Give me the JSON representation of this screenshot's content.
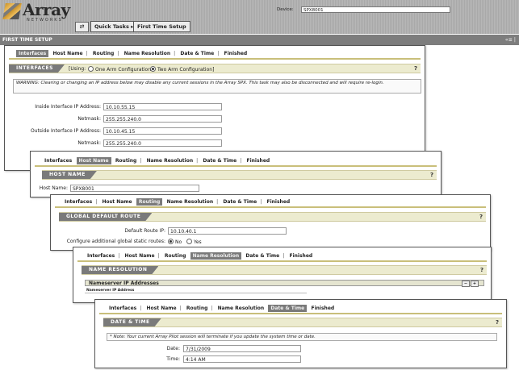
{
  "header": {
    "logo": "Array",
    "logo_sub": "NETWORKS",
    "device_label": "Device:",
    "device_value": "SPX8001",
    "quick_tasks": "Quick Tasks ▸",
    "first_time_setup": "First Time Setup"
  },
  "window": {
    "title": "FIRST TIME SETUP",
    "title_right": "«≡ |"
  },
  "tabs": {
    "interfaces": "Interfaces",
    "host_name": "Host Name",
    "routing": "Routing",
    "name_resolution": "Name Resolution",
    "date_time": "Date & Time",
    "finished": "Finished",
    "separator": "|"
  },
  "help": "?",
  "interfaces_panel": {
    "banner": "INTERFACES",
    "using_label": "[Using:",
    "one_arm": "One Arm Configuration",
    "two_arm": "Two Arm Configuration]",
    "selected": "two_arm",
    "warning": "WARNING: Clearing or changing an IP address below may disable any current sessions in the Array SPX. This task may also be disconnected and will require re-login.",
    "inside_ip_label": "Inside Interface IP Address:",
    "inside_ip": "10.10.55.15",
    "inside_mask_label": "Netmask:",
    "inside_mask": "255.255.240.0",
    "outside_ip_label": "Outside Interface IP Address:",
    "outside_ip": "10.10.45.15",
    "outside_mask_label": "Netmask:",
    "outside_mask": "255.255.240.0"
  },
  "hostname_panel": {
    "banner": "HOST NAME",
    "label": "Host Name:",
    "value": "SPX8001"
  },
  "routing_panel": {
    "banner": "GLOBAL DEFAULT ROUTE",
    "default_route_label": "Default Route IP:",
    "default_route": "10.10.40.1",
    "static_label": "Configure additional global static routes:",
    "no": "No",
    "yes": "Yes",
    "selected": "no"
  },
  "nameres_panel": {
    "banner": "NAME RESOLUTION",
    "list_title": "Nameserver IP Addresses",
    "minus": "−",
    "plus": "+",
    "column": "Nameserver IP Address"
  },
  "datetime_panel": {
    "banner": "DATE & TIME",
    "note": "* Note: Your current Array Pilot session will terminate if you update the system time or date.",
    "date_label": "Date:",
    "date": "7/31/2009",
    "time_label": "Time:",
    "time": "4:14 AM"
  },
  "colors": {
    "active_tab": "#7a7a7a",
    "banner_bg": "#ecebcf",
    "accent_line": "#c9bf7a",
    "titlebar": "#7d7d7d"
  }
}
